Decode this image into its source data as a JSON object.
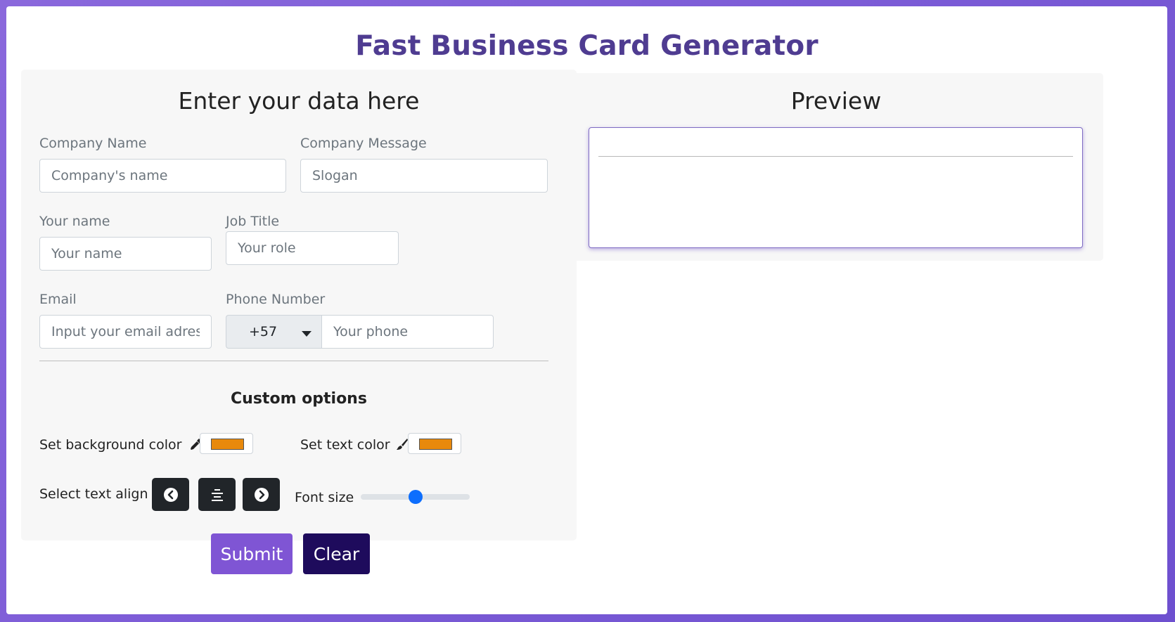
{
  "app": {
    "title": "Fast Business Card Generator"
  },
  "form": {
    "heading": "Enter your data here",
    "company_name": {
      "label": "Company Name",
      "placeholder": "Company's name",
      "value": ""
    },
    "company_message": {
      "label": "Company Message",
      "placeholder": "Slogan",
      "value": ""
    },
    "your_name": {
      "label": "Your name",
      "placeholder": "Your name",
      "value": ""
    },
    "job_title": {
      "label": "Job Title",
      "placeholder": "Your role",
      "value": ""
    },
    "email": {
      "label": "Email",
      "placeholder": "Input your email adress",
      "value": ""
    },
    "phone": {
      "label": "Phone Number",
      "country_code": "+57",
      "placeholder": "Your phone",
      "value": ""
    }
  },
  "custom": {
    "heading": "Custom options",
    "bg_color_label": "Set background color",
    "bg_color_icon": "eyedropper-icon",
    "bg_color": "#e8890c",
    "text_color_label": "Set text color",
    "text_color_icon": "paintbrush-icon",
    "text_color": "#e8890c",
    "align_label": "Select text align",
    "align_buttons": [
      "align-left-icon",
      "align-center-icon",
      "align-right-icon"
    ],
    "font_size_label": "Font size",
    "font_size_fraction": 0.5
  },
  "buttons": {
    "submit": "Submit",
    "clear": "Clear"
  },
  "preview": {
    "heading": "Preview"
  },
  "colors": {
    "title": "#4f3c91",
    "submit": "#7f55d4",
    "clear": "#1e0b5c",
    "accent": "#0d6efd"
  }
}
